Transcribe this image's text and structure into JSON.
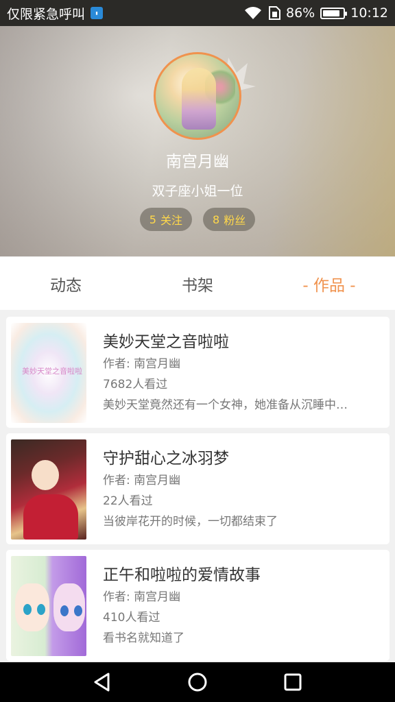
{
  "status_bar": {
    "carrier": "仅限紧急呼叫",
    "battery_percent": "86%",
    "battery_level": 0.86,
    "time": "10:12",
    "icons": [
      "sim-icon",
      "wifi-icon",
      "sim-card-icon",
      "battery-icon"
    ]
  },
  "profile": {
    "name": "南宫月幽",
    "bio": "双子座小姐一位",
    "following": {
      "count": "5",
      "label": "关注"
    },
    "followers": {
      "count": "8",
      "label": "粉丝"
    },
    "accent_color": "#f0924d",
    "stat_color": "#ffd84a"
  },
  "tabs": [
    {
      "label": "动态",
      "active": false
    },
    {
      "label": "书架",
      "active": false
    },
    {
      "label": "- 作品 -",
      "active": true
    }
  ],
  "works": [
    {
      "title": "美妙天堂之音啦啦",
      "author": "作者: 南宫月幽",
      "views": "7682人看过",
      "summary": "美妙天堂竟然还有一个女神，她准备从沉睡中…",
      "cover_text": "美妙天堂之音啦啦"
    },
    {
      "title": "守护甜心之冰羽梦",
      "author": "作者: 南宫月幽",
      "views": "22人看过",
      "summary": "当彼岸花开的时候，一切都结束了"
    },
    {
      "title": "正午和啦啦的爱情故事",
      "author": "作者: 南宫月幽",
      "views": "410人看过",
      "summary": "看书名就知道了"
    }
  ],
  "nav": {
    "icons": [
      "back-icon",
      "home-icon",
      "recents-icon"
    ]
  }
}
